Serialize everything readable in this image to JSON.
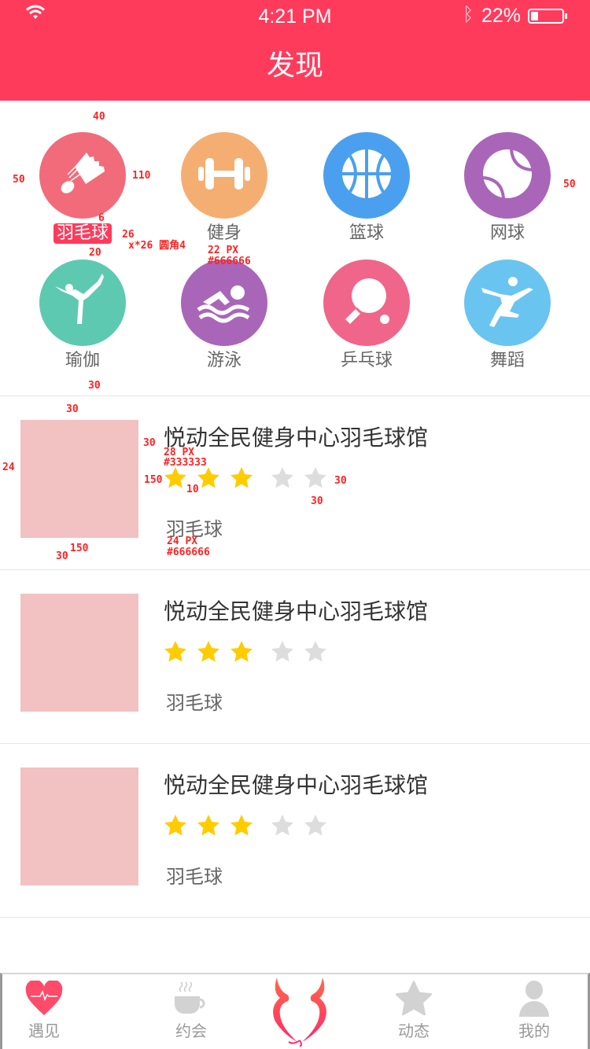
{
  "status_bar": {
    "time": "4:21 PM",
    "battery": "22%",
    "battery_level": 0.22
  },
  "nav": {
    "title": "发现"
  },
  "categories": [
    {
      "label": "羽毛球",
      "icon": "badminton-icon",
      "color": "#f26b7a",
      "selected": true
    },
    {
      "label": "健身",
      "icon": "dumbbell-icon",
      "color": "#f5ae72"
    },
    {
      "label": "篮球",
      "icon": "basketball-icon",
      "color": "#4aa0ee"
    },
    {
      "label": "网球",
      "icon": "tennis-icon",
      "color": "#a966b9"
    },
    {
      "label": "瑜伽",
      "icon": "yoga-icon",
      "color": "#5ec9b1"
    },
    {
      "label": "游泳",
      "icon": "swimming-icon",
      "color": "#a966b9"
    },
    {
      "label": "乒乓球",
      "icon": "pingpong-icon",
      "color": "#f0658a"
    },
    {
      "label": "舞蹈",
      "icon": "dance-icon",
      "color": "#6ac4f0"
    }
  ],
  "venues": [
    {
      "title": "悦动全民健身中心羽毛球馆",
      "rating": 3,
      "max_rating": 5,
      "tag": "羽毛球"
    },
    {
      "title": "悦动全民健身中心羽毛球馆",
      "rating": 3,
      "max_rating": 5,
      "tag": "羽毛球"
    },
    {
      "title": "悦动全民健身中心羽毛球馆",
      "rating": 3,
      "max_rating": 5,
      "tag": "羽毛球"
    }
  ],
  "tabbar": {
    "items": [
      {
        "label": "遇见"
      },
      {
        "label": "约会"
      },
      {
        "label": ""
      },
      {
        "label": "动态"
      },
      {
        "label": "我的"
      }
    ]
  },
  "annotations": {
    "a40": "40",
    "a110": "110",
    "a50l": "50",
    "a50r": "50",
    "a6": "6",
    "a26": "26",
    "a_size": "x*26 圆角4",
    "a20": "20",
    "a22": "22 PX",
    "a666a": "#666666",
    "a30a": "30",
    "a30b": "30",
    "a30c": "30",
    "a24": "24",
    "a150h": "150",
    "a28": "28 PX",
    "a333": "#333333",
    "a10": "10",
    "a30d": "30",
    "a30e": "30",
    "a24px": "24 PX",
    "a666b": "#666666",
    "a150w": "150",
    "a30f": "30"
  },
  "colors": {
    "brand": "#ff3b5c",
    "star_on": "#ffcc00",
    "star_off": "#dddddd"
  }
}
